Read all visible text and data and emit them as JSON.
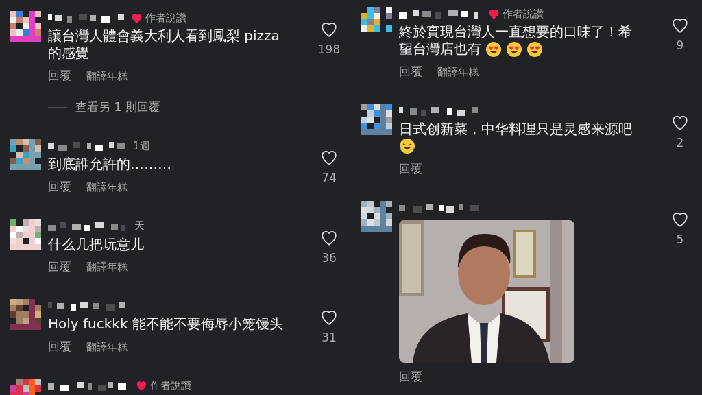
{
  "columns": [
    {
      "comments": [
        {
          "author_liked": true,
          "author_badge": "作者說讚",
          "lines": [
            {
              "text": "讓台灣人體會義大利人看到鳳梨 pizza"
            },
            {
              "text": "的感覺"
            }
          ],
          "actions": [
            "回覆",
            "翻譯年糕"
          ],
          "view_replies": "查看另 1 則回覆",
          "liked": false,
          "likes": "198"
        },
        {
          "time": "1週",
          "lines": [
            {
              "text": "到底誰允許的………"
            }
          ],
          "actions": [
            "回覆",
            "翻譯年糕"
          ],
          "liked": false,
          "likes": "74"
        },
        {
          "time": "天",
          "lines": [
            {
              "text": "什么几把玩意儿"
            }
          ],
          "actions": [
            "回覆",
            "翻譯年糕"
          ],
          "liked": false,
          "likes": "36"
        },
        {
          "lines": [
            {
              "text": "Holy fuckkk 能不能不要侮辱小笼馒头"
            }
          ],
          "actions": [
            "回覆",
            "翻譯年糕"
          ],
          "liked": false,
          "likes": "31"
        },
        {
          "author_liked": true,
          "author_badge": "作者說讚"
        }
      ]
    },
    {
      "comments": [
        {
          "author_liked": true,
          "author_badge": "作者說讚",
          "lines": [
            {
              "text": "終於實現台灣人一直想要的口味了！希"
            },
            {
              "text": "望台灣店也有",
              "emojis": [
                {
                  "kind": "heart_eyes"
                },
                {
                  "kind": "heart_eyes"
                },
                {
                  "kind": "heart_eyes"
                }
              ]
            }
          ],
          "actions": [
            "回覆",
            "翻譯年糕"
          ],
          "liked": false,
          "likes": "9"
        },
        {
          "lines": [
            {
              "text": "日式创新菜，中华料理只是灵感来源吧"
            },
            {
              "emojis": [
                {
                  "kind": "tears_of_joy"
                }
              ]
            }
          ],
          "actions": [
            "回覆"
          ],
          "liked": false,
          "likes": "2"
        },
        {
          "media": {
            "kind": "picture"
          },
          "actions": [
            "回覆"
          ],
          "liked": false,
          "likes": "5"
        }
      ]
    }
  ]
}
